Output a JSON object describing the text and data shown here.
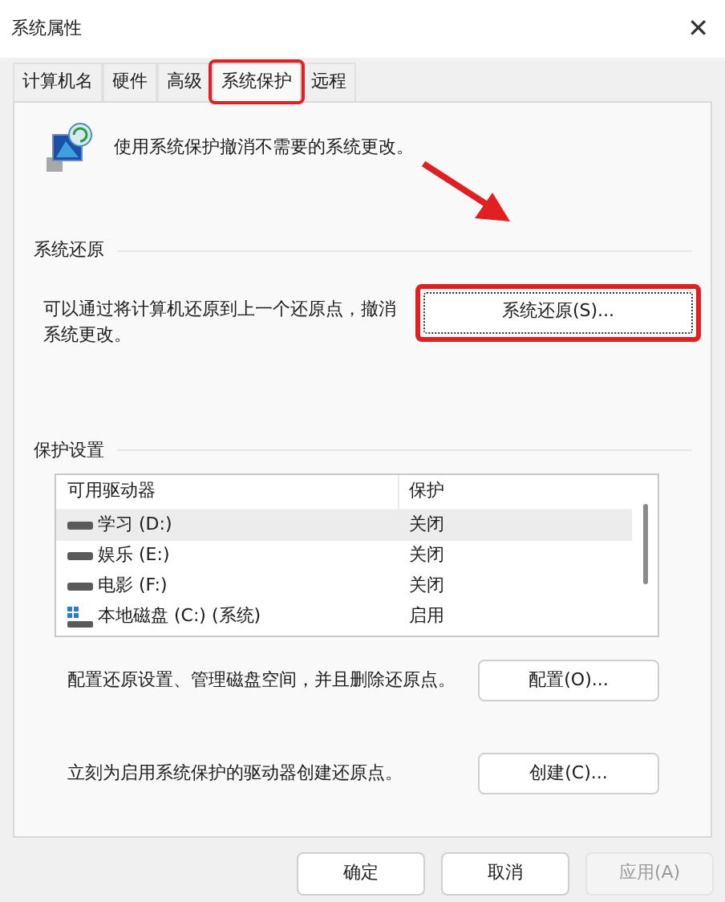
{
  "window": {
    "title": "系统属性",
    "close": "✕"
  },
  "tabs": [
    {
      "label": "计算机名",
      "selected": false,
      "highlighted": false
    },
    {
      "label": "硬件",
      "selected": false,
      "highlighted": false
    },
    {
      "label": "高级",
      "selected": false,
      "highlighted": false
    },
    {
      "label": "系统保护",
      "selected": true,
      "highlighted": true
    },
    {
      "label": "远程",
      "selected": false,
      "highlighted": false
    }
  ],
  "intro": "使用系统保护撤消不需要的系统更改。",
  "restore": {
    "heading": "系统还原",
    "text": "可以通过将计算机还原到上一个还原点，撤消系统更改。",
    "button": {
      "label": "系统还原(S)...",
      "highlighted": true
    }
  },
  "protection": {
    "heading": "保护设置",
    "columns": [
      "可用驱动器",
      "保护"
    ],
    "rows": [
      {
        "drive": "学习 (D:)",
        "status": "关闭",
        "kind": "data",
        "selected": true
      },
      {
        "drive": "娱乐 (E:)",
        "status": "关闭",
        "kind": "data",
        "selected": false
      },
      {
        "drive": "电影 (F:)",
        "status": "关闭",
        "kind": "data",
        "selected": false
      },
      {
        "drive": "本地磁盘 (C:) (系统)",
        "status": "启用",
        "kind": "system",
        "selected": false
      }
    ],
    "actions": [
      {
        "text": "配置还原设置、管理磁盘空间，并且删除还原点。",
        "button": "配置(O)..."
      },
      {
        "text": "立刻为启用系统保护的驱动器创建还原点。",
        "button": "创建(C)..."
      }
    ]
  },
  "buttons": [
    {
      "label": "确定",
      "disabled": false
    },
    {
      "label": "取消",
      "disabled": false
    },
    {
      "label": "应用(A)",
      "disabled": true
    }
  ]
}
